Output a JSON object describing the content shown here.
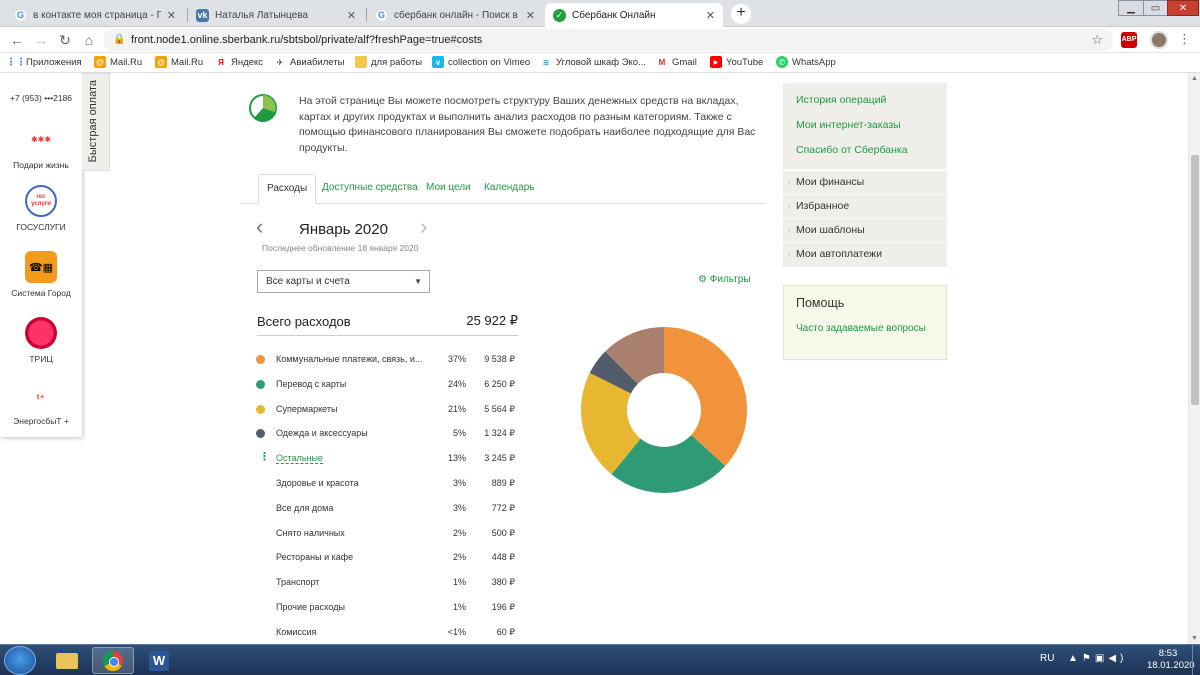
{
  "browser": {
    "tabs": [
      {
        "title": "в контакте моя страница - Поис",
        "icon": "google-icon"
      },
      {
        "title": "Наталья Латынцева",
        "icon": "vk-icon"
      },
      {
        "title": "сбербанк онлайн - Поиск в Goo",
        "icon": "google-icon"
      },
      {
        "title": "Сбербанк Онлайн",
        "icon": "sberbank-icon",
        "active": true
      }
    ],
    "new_tab_label": "+",
    "url": "front.node1.online.sberbank.ru/sbtsbol/private/alf?freshPage=true#costs",
    "extension_badge": "ABP",
    "bookmarks": [
      {
        "label": "Приложения",
        "icon": "apps-grid-icon"
      },
      {
        "label": "Mail.Ru",
        "icon": "mailru-icon"
      },
      {
        "label": "Mail.Ru",
        "icon": "mailru-icon"
      },
      {
        "label": "Яндекс",
        "icon": "yandex-icon"
      },
      {
        "label": "Авиабилеты",
        "icon": "plane-icon"
      },
      {
        "label": "для работы",
        "icon": "folder-icon"
      },
      {
        "label": "collection on Vimeo",
        "icon": "vimeo-icon"
      },
      {
        "label": "Угловой шкаф Эко...",
        "icon": "wifi-icon"
      },
      {
        "label": "Gmail",
        "icon": "gmail-icon"
      },
      {
        "label": "YouTube",
        "icon": "youtube-icon"
      },
      {
        "label": "WhatsApp",
        "icon": "whatsapp-icon"
      }
    ]
  },
  "fast_panel": {
    "phone": "+7 (953) •••2186",
    "quick_pay_label": "Быстрая оплата",
    "items": [
      {
        "label": "Подари жизнь",
        "icon": "podari-zhizn-logo-icon"
      },
      {
        "label": "ГОСУСЛУГИ",
        "icon": "gosuslugi-logo-icon",
        "badge": "гос услуги"
      },
      {
        "label": "Система Город",
        "icon": "sistema-gorod-icon"
      },
      {
        "label": "ТРИЦ",
        "icon": "tric-logo-icon"
      },
      {
        "label": "ЭнергосбыТ +",
        "icon": "energosbyt-logo-icon"
      }
    ]
  },
  "intro": {
    "text": "На этой странице Вы можете посмотреть структуру Ваших денежных средств на вкладах, картах и других продуктах и выполнить анализ расходов по разным категориям. Также с помощью финансового планирования Вы сможете подобрать наиболее подходящие для Вас продукты."
  },
  "finance_tabs": [
    {
      "label": "Расходы",
      "active": true
    },
    {
      "label": "Доступные средства"
    },
    {
      "label": "Мои цели"
    },
    {
      "label": "Календарь"
    }
  ],
  "period": {
    "month": "Январь 2020",
    "updated": "Последнее обновление 18 января 2020"
  },
  "account_select": {
    "value": "Все карты и счета"
  },
  "filters_label": "Фильтры",
  "totals": {
    "label": "Всего расходов",
    "value": "25 922 ₽"
  },
  "categories": [
    {
      "name": "Коммунальные платежи, связь, и...",
      "pct": "37%",
      "amount": "9 538 ₽",
      "color": "#f0933a"
    },
    {
      "name": "Перевод с карты",
      "pct": "24%",
      "amount": "6 250 ₽",
      "color": "#2e9b74"
    },
    {
      "name": "Супермаркеты",
      "pct": "21%",
      "amount": "5 564 ₽",
      "color": "#e8b731"
    },
    {
      "name": "Одежда и аксессуары",
      "pct": "5%",
      "amount": "1 324 ₽",
      "color": "#525c6b"
    },
    {
      "name": "Остальные",
      "pct": "13%",
      "amount": "3 245 ₽",
      "color": "#a8806d"
    }
  ],
  "other_categories": [
    {
      "name": "Здоровье и красота",
      "pct": "3%",
      "amount": "889 ₽"
    },
    {
      "name": "Все для дома",
      "pct": "3%",
      "amount": "772 ₽"
    },
    {
      "name": "Снято наличных",
      "pct": "2%",
      "amount": "500 ₽"
    },
    {
      "name": "Рестораны и кафе",
      "pct": "2%",
      "amount": "448 ₽"
    },
    {
      "name": "Транспорт",
      "pct": "1%",
      "amount": "380 ₽"
    },
    {
      "name": "Прочие расходы",
      "pct": "1%",
      "amount": "196 ₽"
    },
    {
      "name": "Комиссия",
      "pct": "<1%",
      "amount": "60 ₽"
    }
  ],
  "chart_data": {
    "type": "pie",
    "categories": [
      "Коммунальные платежи, связь, и...",
      "Перевод с карты",
      "Супермаркеты",
      "Одежда и аксессуары",
      "Остальные"
    ],
    "values": [
      9538,
      6250,
      5564,
      1324,
      3245
    ],
    "colors": [
      "#f0933a",
      "#2e9b74",
      "#e8b731",
      "#525c6b",
      "#a8806d"
    ],
    "donut": true
  },
  "right_links": [
    "История операций",
    "Мои интернет-заказы",
    "Спасибо от Сбербанка"
  ],
  "right_menu": [
    "Мои финансы",
    "Избранное",
    "Мои шаблоны",
    "Мои автоплатежи"
  ],
  "help": {
    "title": "Помощь",
    "link": "Часто задаваемые вопросы"
  },
  "taskbar": {
    "lang": "RU",
    "time": "8:53",
    "date": "18.01.2020"
  },
  "colors": {
    "accent": "#1f9a45",
    "panel": "#efeee9"
  }
}
